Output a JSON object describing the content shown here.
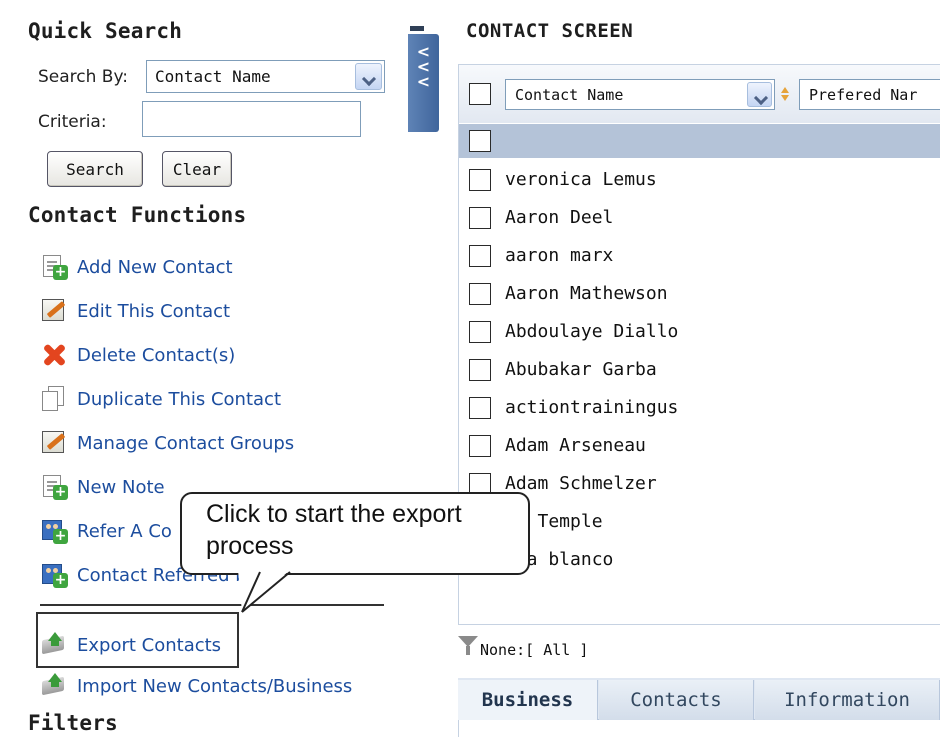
{
  "quick_search": {
    "title": "Quick Search",
    "search_by_label": "Search By:",
    "search_by_value": "Contact Name",
    "criteria_label": "Criteria:",
    "criteria_value": "",
    "search_button": "Search",
    "clear_button": "Clear"
  },
  "contact_functions": {
    "title": "Contact Functions",
    "items": [
      {
        "label": "Add New Contact",
        "icon": "add-contact-icon"
      },
      {
        "label": "Edit This Contact",
        "icon": "edit-icon"
      },
      {
        "label": "Delete Contact(s)",
        "icon": "delete-icon"
      },
      {
        "label": "Duplicate This Contact",
        "icon": "duplicate-icon"
      },
      {
        "label": "Manage Contact Groups",
        "icon": "edit-icon"
      },
      {
        "label": "New Note",
        "icon": "add-note-icon"
      },
      {
        "label": "Refer A Co",
        "icon": "refer-icon"
      },
      {
        "label": "Contact Referred b",
        "icon": "referred-icon"
      },
      {
        "label": "Export Contacts",
        "icon": "export-icon"
      },
      {
        "label": "Import New Contacts/Business",
        "icon": "import-icon"
      }
    ]
  },
  "filters": {
    "title": "Filters"
  },
  "callout": {
    "line1": "Click to start the export",
    "line2": "process"
  },
  "splitter": {
    "collapse_glyph": "<<<"
  },
  "contact_screen": {
    "title": "CONTACT SCREEN",
    "column1": "Contact Name",
    "column2": "Prefered Nar",
    "rows": [
      "veronica Lemus",
      "Aaron Deel",
      "aaron marx",
      "Aaron Mathewson",
      "Abdoulaye Diallo",
      "Abubakar Garba",
      "actiontrainingus",
      "Adam Arseneau",
      "Adam Schmelzer",
      "am Temple",
      "ela blanco"
    ],
    "filter_text": "None:[ All ]",
    "tabs": [
      "Business",
      "Contacts",
      "Information"
    ],
    "active_tab": "Business"
  },
  "colors": {
    "link": "#1c4d9e",
    "selected_row": "#b4c3d8",
    "splitter": "#4a6fa5"
  }
}
